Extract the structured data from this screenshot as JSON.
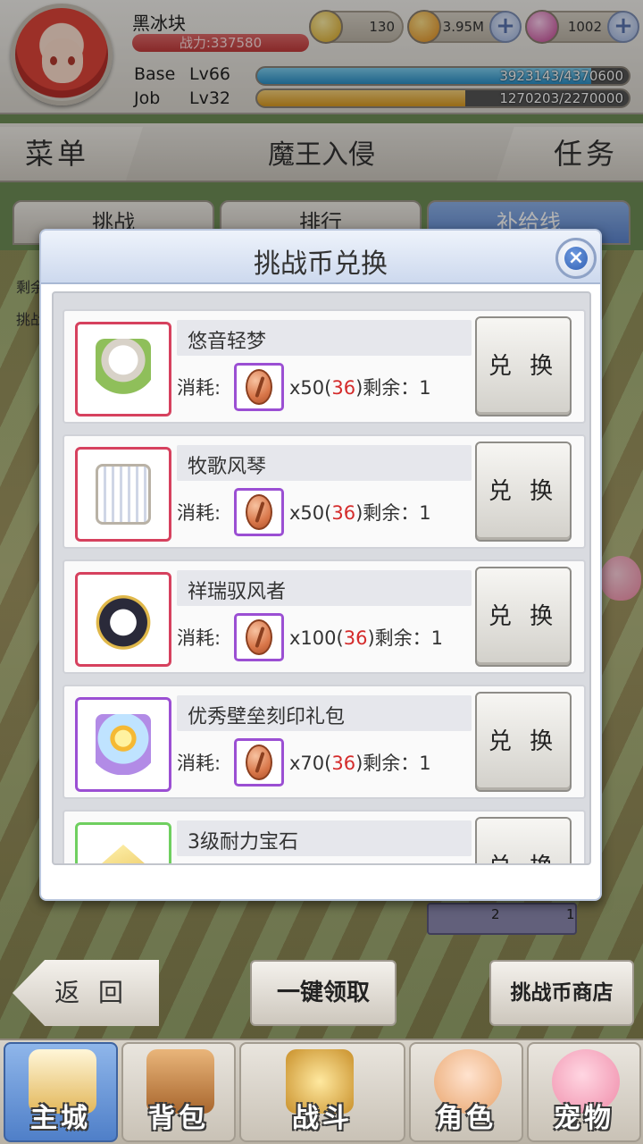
{
  "player": {
    "name": "黑冰块",
    "power_label": "战力:337580",
    "base_label": "Base",
    "base_level": "Lv66",
    "base_exp": "3923143/4370600",
    "base_exp_fraction": 0.898,
    "job_label": "Job",
    "job_level": "Lv32",
    "job_exp": "1270203/2270000",
    "job_exp_fraction": 0.56
  },
  "resources": [
    {
      "icon": "zeny-coin-icon",
      "value": "130"
    },
    {
      "icon": "gold-coin-icon",
      "value": "3.95M"
    },
    {
      "icon": "crystal-gem-icon",
      "value": "1002"
    }
  ],
  "nav": {
    "menu_label": "菜单",
    "title": "魔王入侵",
    "task_label": "任务"
  },
  "subtabs": [
    "挑战",
    "排行",
    "补给线"
  ],
  "side_texts": [
    "剩余",
    "挑战"
  ],
  "background_counts": [
    "2",
    "1"
  ],
  "modal": {
    "title": "挑战币兑换",
    "cost_label": "消耗:",
    "remaining_label": "剩余：",
    "exchange_label": "兑 换",
    "coin_icon": "challenge-coin-icon",
    "items": [
      {
        "name": "悠音轻梦",
        "cost_prefix": "x50(",
        "have": "36",
        "cost_suffix": ")",
        "remaining": "1",
        "rarity": "red"
      },
      {
        "name": "牧歌风琴",
        "cost_prefix": "x50(",
        "have": "36",
        "cost_suffix": ")",
        "remaining": "1",
        "rarity": "red"
      },
      {
        "name": "祥瑞驭风者",
        "cost_prefix": "x100(",
        "have": "36",
        "cost_suffix": ")",
        "remaining": "1",
        "rarity": "red"
      },
      {
        "name": "优秀壁垒刻印礼包",
        "cost_prefix": "x70(",
        "have": "36",
        "cost_suffix": ")",
        "remaining": "1",
        "rarity": "purple"
      },
      {
        "name": "3级耐力宝石",
        "cost_prefix": "",
        "have": "",
        "cost_suffix": "",
        "remaining": "",
        "rarity": "green"
      }
    ]
  },
  "bottom_buttons": {
    "back": "返 回",
    "claim_all": "一键领取",
    "coin_shop": "挑战币商店"
  },
  "bottom_nav": [
    {
      "label": "主城",
      "icon": "castle-icon",
      "active": true
    },
    {
      "label": "背包",
      "icon": "backpack-icon",
      "active": false
    },
    {
      "label": "战斗",
      "icon": "crossed-swords-icon",
      "active": false
    },
    {
      "label": "角色",
      "icon": "character-icon",
      "active": false
    },
    {
      "label": "宠物",
      "icon": "poring-pet-icon",
      "active": false
    }
  ],
  "colors": {
    "accent_blue": "#5d86cf",
    "power_red": "#c33b3b",
    "base_exp": "#3fa2d6",
    "job_exp": "#e0a73a",
    "have_count": "#d42b2b"
  }
}
